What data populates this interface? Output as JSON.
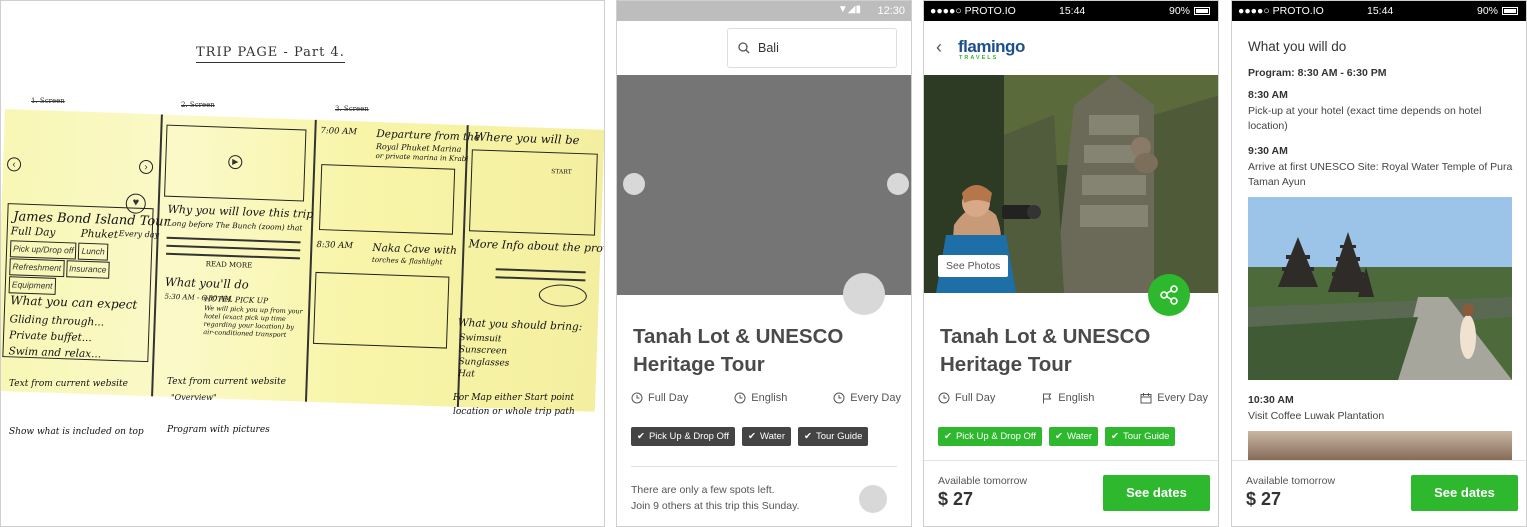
{
  "sketch": {
    "title": "TRIP PAGE - Part 4.",
    "col_heads": [
      "1. Screen",
      "2. Screen",
      "3. Screen"
    ],
    "col1": {
      "tour_title": "James Bond Island Tour",
      "full_day": "Full Day",
      "location": "Phuket",
      "every_day": "Every day",
      "tags": [
        "Pick up/Drop off",
        "Lunch",
        "Refreshment",
        "Insurance",
        "Equipment"
      ],
      "expect_head": "What you can expect",
      "bullets": [
        "Gliding through...",
        "Private buffet...",
        "Swim and relax..."
      ],
      "note": "Text from current website",
      "note2": "Show what is included on top"
    },
    "col2": {
      "why_head": "Why you will love this trip",
      "why_sub": "Long before The Bunch (zoom) that",
      "read_more": "READ MORE",
      "do_head": "What you'll do",
      "do_time": "5:30 AM - 6:30 AM",
      "do_txt1": "HOTEL PICK UP",
      "do_txt2": "We will pick you up from your hotel (exact pick up time regarding your location) by air-conditioned transport",
      "note": "Text from current website",
      "note_overview": "\"Overview\"",
      "note2": "Program with pictures"
    },
    "col3": {
      "t1": "7:00 AM",
      "t1_txt1": "Departure from the",
      "t1_txt2": "Royal Phuket Marina",
      "t1_txt3": "or private marina in Krabi",
      "t2": "8:30 AM",
      "t2_txt1": "Naka Cave with",
      "t2_txt2": "torches & flashlight"
    },
    "col4": {
      "where_head": "Where you will be",
      "start": "START",
      "more_head": "More Info about the provider",
      "bring_head": "What you should bring:",
      "bring": [
        "Swimsuit",
        "Sunscreen",
        "Sunglasses",
        "Hat"
      ],
      "note": "For Map either Start point location or whole trip path"
    }
  },
  "wire": {
    "status_time": "12:30",
    "search_value": "Bali",
    "title_l1": "Tanah Lot & UNESCO",
    "title_l2": "Heritage Tour",
    "meta": [
      "Full Day",
      "English",
      "Every Day"
    ],
    "tags": [
      "Pick Up & Drop Off",
      "Water",
      "Tour Guide"
    ],
    "spots_l1": "There are only a few spots left.",
    "spots_l2": "Join 9 others at this trip this Sunday."
  },
  "mock": {
    "status": {
      "carrier": "●●●●○ PROTO.IO",
      "time": "15:44",
      "battery": "90%"
    },
    "brand_name": "flamingo",
    "brand_sub": "TRAVELS",
    "see_photos": "See Photos",
    "title_l1": "Tanah Lot & UNESCO",
    "title_l2": "Heritage Tour",
    "meta": [
      "Full Day",
      "English",
      "Every Day"
    ],
    "tags": [
      "Pick Up & Drop Off",
      "Water",
      "Tour Guide"
    ],
    "available": "Available tomorrow",
    "price": "$ 27",
    "see_dates": "See dates"
  },
  "program": {
    "status": {
      "carrier": "●●●●○ PROTO.IO",
      "time": "15:44",
      "battery": "90%"
    },
    "heading": "What you will do",
    "program_line": "Program: 8:30 AM - 6:30 PM",
    "items": [
      {
        "time": "8:30 AM",
        "text": "Pick-up at your hotel (exact time depends on hotel location)"
      },
      {
        "time": "9:30 AM",
        "text": "Arrive at first UNESCO Site: Royal Water Temple of Pura Taman Ayun"
      },
      {
        "time": "10:30 AM",
        "text": "Visit Coffee Luwak Plantation"
      }
    ],
    "available": "Available tomorrow",
    "price": "$ 27",
    "see_dates": "See dates"
  },
  "colors": {
    "green": "#2eb82e",
    "brand_blue": "#1d4f8f",
    "dark_tag": "#444444",
    "grey_hero": "#757575",
    "sketch_yellow": "#f8f7b5"
  }
}
